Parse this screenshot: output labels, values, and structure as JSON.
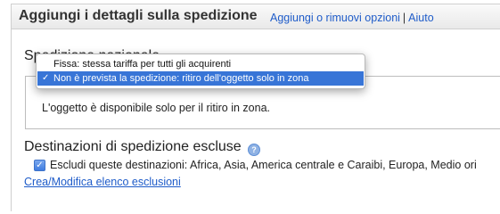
{
  "header": {
    "title": "Aggiungi i dettagli sulla spedizione",
    "link_options": "Aggiungi o rimuovi opzioni",
    "separator": "|",
    "link_help": "Aiuto"
  },
  "domestic": {
    "heading": "Spedizione nazionale",
    "dropdown_options": [
      "Fissa: stessa tariffa per tutti gli acquirenti",
      "Non è prevista la spedizione: ritiro dell'oggetto solo in zona"
    ],
    "selected_index": 1,
    "note": "L'oggetto è disponibile solo per il ritiro in zona."
  },
  "excluded": {
    "heading": "Destinazioni di spedizione escluse",
    "help_icon": "question-icon",
    "checkbox_checked": true,
    "checkbox_label": "Escludi queste destinazioni: Africa, Asia, America centrale e Caraibi, Europa, Medio ori",
    "edit_link": "Crea/Modifica elenco esclusioni"
  }
}
